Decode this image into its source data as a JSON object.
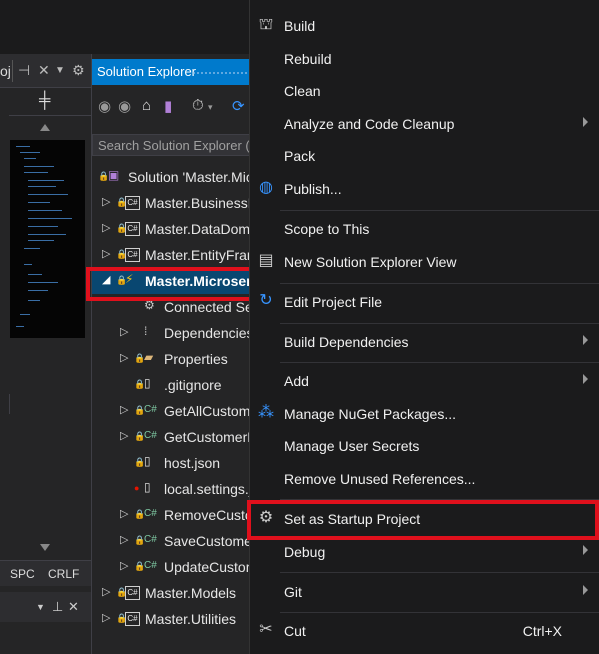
{
  "left_panel": {
    "header_text": "oj",
    "status_items": [
      "SPC",
      "CRLF"
    ]
  },
  "solution_explorer": {
    "title": "Solution Explorer",
    "search_placeholder": "Search Solution Explorer (Ctrl+;)",
    "tree": [
      {
        "label": "Solution 'Master.Microservices'",
        "icon": "solution-icon"
      },
      {
        "label": "Master.BusinessDomain",
        "icon": "csharp-project-icon"
      },
      {
        "label": "Master.DataDomain",
        "icon": "csharp-project-icon"
      },
      {
        "label": "Master.EntityFramework",
        "icon": "csharp-project-icon"
      },
      {
        "label": "Master.Microservices",
        "icon": "function-project-icon",
        "selected": true
      },
      {
        "label": "Connected Services",
        "icon": "connected-services-icon"
      },
      {
        "label": "Dependencies",
        "icon": "dependencies-icon"
      },
      {
        "label": "Properties",
        "icon": "properties-folder-icon"
      },
      {
        "label": ".gitignore",
        "icon": "file-icon"
      },
      {
        "label": "GetAllCustomers.cs",
        "icon": "csharp-file-icon"
      },
      {
        "label": "GetCustomerById.cs",
        "icon": "csharp-file-icon"
      },
      {
        "label": "host.json",
        "icon": "json-file-icon"
      },
      {
        "label": "local.settings.json",
        "icon": "json-file-icon"
      },
      {
        "label": "RemoveCustomer.cs",
        "icon": "csharp-file-icon"
      },
      {
        "label": "SaveCustomerData.cs",
        "icon": "csharp-file-icon"
      },
      {
        "label": "UpdateCustomer.cs",
        "icon": "csharp-file-icon"
      },
      {
        "label": "Master.Models",
        "icon": "csharp-project-icon"
      },
      {
        "label": "Master.Utilities",
        "icon": "csharp-project-icon"
      }
    ]
  },
  "context_menu": {
    "items": [
      {
        "label": "Build",
        "icon": "build-icon"
      },
      {
        "label": "Rebuild"
      },
      {
        "label": "Clean"
      },
      {
        "label": "Analyze and Code Cleanup",
        "submenu": true
      },
      {
        "label": "Pack"
      },
      {
        "label": "Publish...",
        "icon": "globe-icon"
      },
      {
        "label": "Scope to This"
      },
      {
        "label": "New Solution Explorer View",
        "icon": "new-view-icon"
      },
      {
        "label": "Edit Project File",
        "icon": "refresh-icon"
      },
      {
        "label": "Build Dependencies",
        "submenu": true
      },
      {
        "label": "Add",
        "submenu": true
      },
      {
        "label": "Manage NuGet Packages...",
        "icon": "nuget-icon"
      },
      {
        "label": "Manage User Secrets"
      },
      {
        "label": "Remove Unused References..."
      },
      {
        "label": "Set as Startup Project",
        "icon": "gear-icon",
        "highlighted": true
      },
      {
        "label": "Debug",
        "submenu": true
      },
      {
        "label": "Git",
        "submenu": true
      },
      {
        "label": "Cut",
        "icon": "scissors-icon",
        "shortcut": "Ctrl+X"
      }
    ]
  },
  "colors": {
    "accent": "#007acc",
    "highlight_box": "#e0101c",
    "menu_bg": "#1b1b1c"
  }
}
